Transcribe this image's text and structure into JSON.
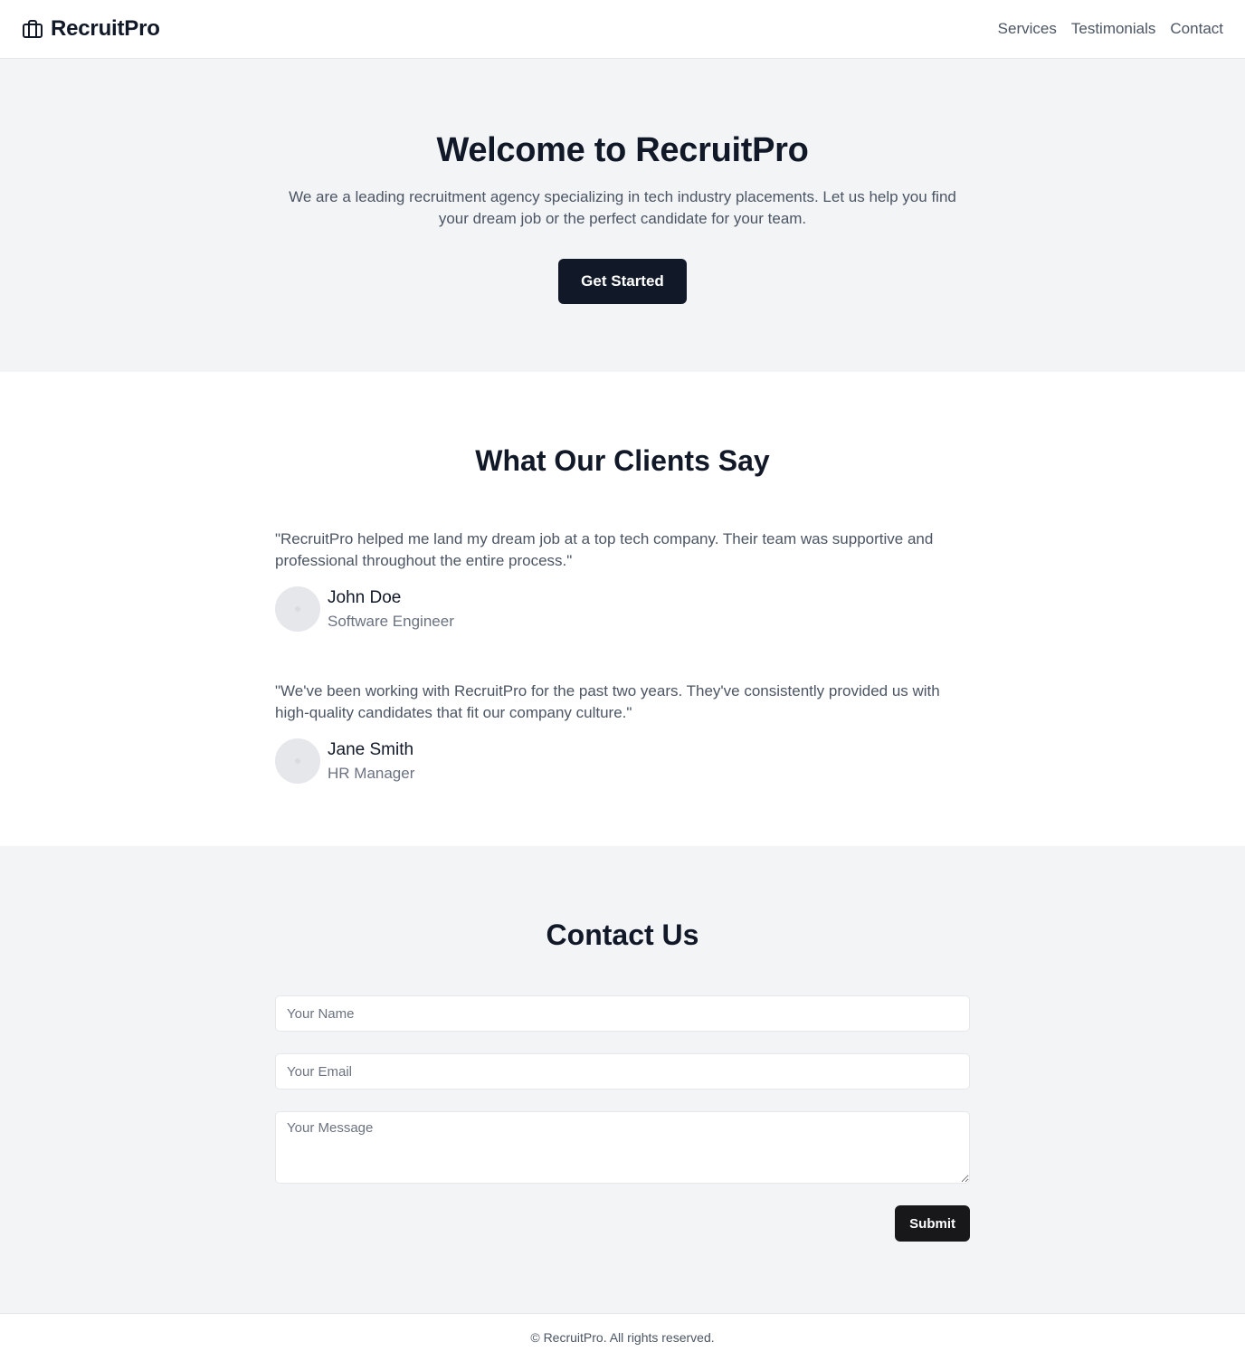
{
  "header": {
    "brand": "RecruitPro",
    "brand_icon": "briefcase-icon",
    "nav": [
      "Services",
      "Testimonials",
      "Contact"
    ]
  },
  "hero": {
    "title": "Welcome to RecruitPro",
    "subtitle": "We are a leading recruitment agency specializing in tech industry placements. Let us help you find your dream job or the perfect candidate for your team.",
    "cta": "Get Started"
  },
  "testimonials": {
    "title": "What Our Clients Say",
    "items": [
      {
        "quote": "\"RecruitPro helped me land my dream job at a top tech company. Their team was supportive and professional throughout the entire process.\"",
        "name": "John Doe",
        "role": "Software Engineer"
      },
      {
        "quote": "\"We've been working with RecruitPro for the past two years. They've consistently provided us with high-quality candidates that fit our company culture.\"",
        "name": "Jane Smith",
        "role": "HR Manager"
      }
    ]
  },
  "contact": {
    "title": "Contact Us",
    "name_placeholder": "Your Name",
    "email_placeholder": "Your Email",
    "message_placeholder": "Your Message",
    "submit": "Submit"
  },
  "footer": {
    "text": "© RecruitPro. All rights reserved."
  },
  "colors": {
    "primary": "#111827",
    "muted_bg": "#f3f4f6",
    "text_muted": "#4b5563"
  }
}
